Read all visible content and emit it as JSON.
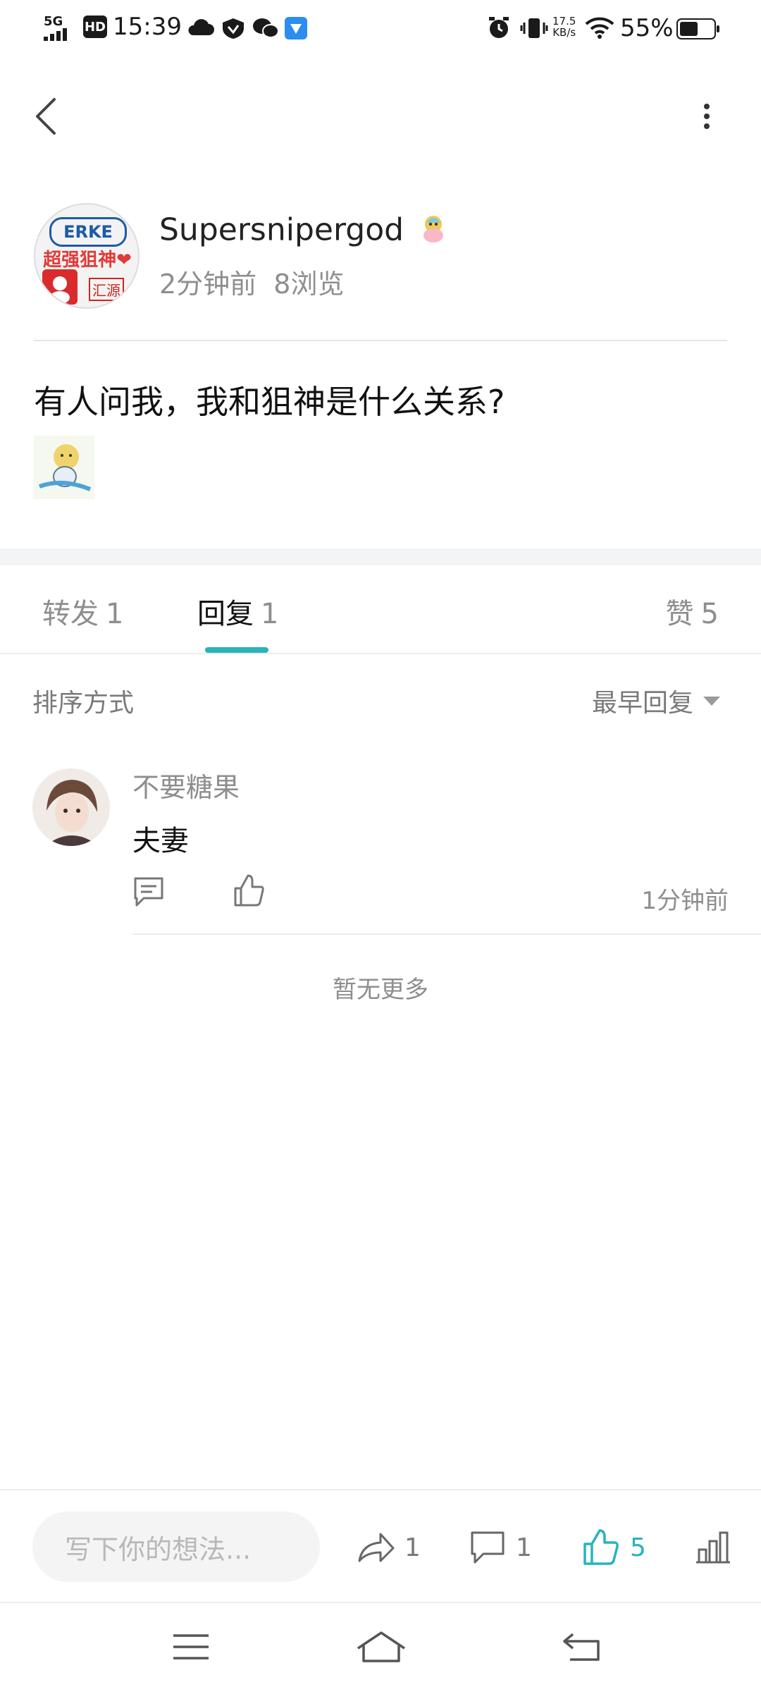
{
  "status_bar": {
    "network": "5G",
    "hd": "HD",
    "time": "15:39",
    "speed_value": "17.5",
    "speed_unit": "KB/s",
    "battery": "55%"
  },
  "header": {
    "back_icon": "chevron-left-icon",
    "more_icon": "more-vertical-icon"
  },
  "post": {
    "author_name": "Supersnipergod",
    "author_badge_icon": "badge-icon",
    "avatar_brand": "ERKE",
    "avatar_text": "超强狙神❤",
    "avatar_small_text": "汇源",
    "meta_time": "2分钟前",
    "meta_views": "8浏览",
    "content": "有人问我，我和狙神是什么关系?"
  },
  "tabs": [
    {
      "label": "转发",
      "count": "1"
    },
    {
      "label": "回复",
      "count": "1",
      "active": true
    },
    {
      "label": "赞",
      "count": "5"
    }
  ],
  "sort": {
    "label": "排序方式",
    "value": "最早回复"
  },
  "comments": [
    {
      "author": "不要糖果",
      "text": "夫妻",
      "time": "1分钟前"
    }
  ],
  "no_more": "暂无更多",
  "bottom_bar": {
    "input_placeholder": "写下你的想法...",
    "share_count": "1",
    "comment_count": "1",
    "like_count": "5"
  },
  "colors": {
    "accent": "#29b3bd",
    "text": "#111111",
    "muted": "#8e8e8e"
  }
}
